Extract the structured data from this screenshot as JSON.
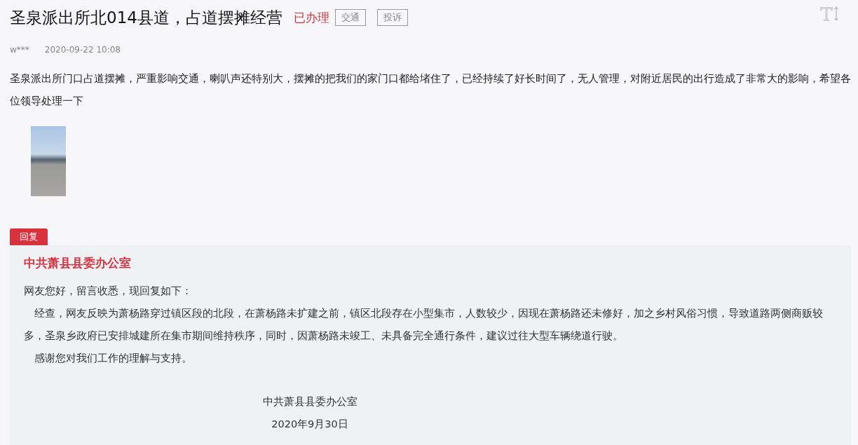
{
  "title": "圣泉派出所北014县道，占道摆摊经营",
  "status": "已办理",
  "tags": [
    "交通",
    "投诉"
  ],
  "author": "w***",
  "time": "2020-09-22 10:08",
  "content": "圣泉派出所门口占道摆摊，严重影响交通，喇叭声还特别大，摆摊的把我们的家门口都给堵住了，已经持续了好长时间了，无人管理，对附近居民的出行造成了非常大的影响，希望各位领导处理一下",
  "reply": {
    "label": "回复",
    "org": "中共萧县县委办公室",
    "paragraphs": [
      "网友您好，留言收悉，现回复如下：",
      "　经查，网友反映为萧杨路穿过镇区段的北段，在萧杨路未扩建之前，镇区北段存在小型集市，人数较少，因现在萧杨路还未修好，加之乡村风俗习惯，导致道路两侧商贩较多，圣泉乡政府已安排城建所在集市期间维持秩序，同时，因萧杨路未竣工、未具备完全通行条件，建议过往大型车辆绕道行驶。",
      "　感谢您对我们工作的理解与支持。"
    ],
    "signature": [
      "中共萧县县委办公室",
      "2020年9月30日"
    ]
  }
}
